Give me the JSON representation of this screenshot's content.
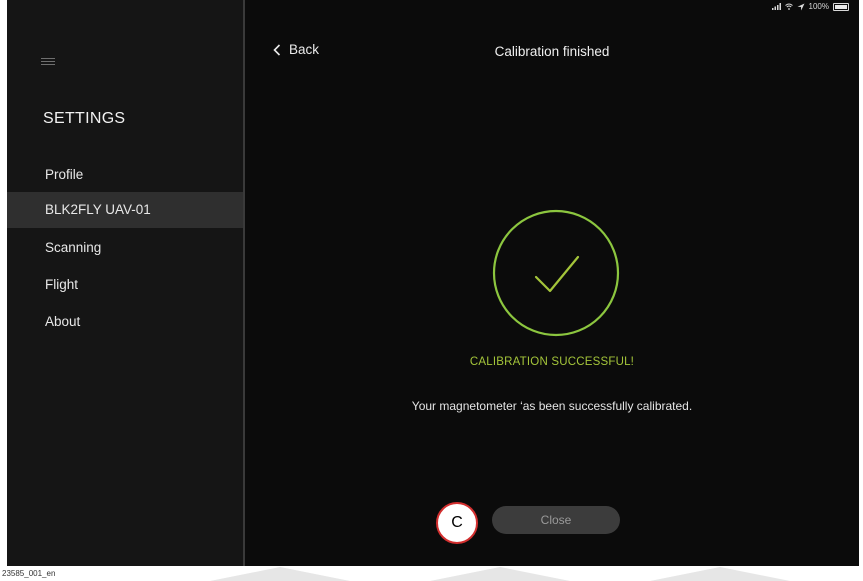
{
  "status_bar": {
    "battery": "100%"
  },
  "sidebar": {
    "title": "SETTINGS",
    "items": [
      {
        "label": "Profile",
        "active": false
      },
      {
        "label": "BLK2FLY UAV-01",
        "active": true
      },
      {
        "label": "Scanning",
        "active": false
      },
      {
        "label": "Flight",
        "active": false
      },
      {
        "label": "About",
        "active": false
      }
    ]
  },
  "header": {
    "back_label": "Back",
    "title": "Calibration finished"
  },
  "main": {
    "status": "CALIBRATION SUCCESSFUL!",
    "description": "Your magnetometer ‘as been successfully calibrated.",
    "close_label": "Close"
  },
  "callout": {
    "label": "C"
  },
  "caption": "23585_001_en",
  "colors": {
    "success": "#a4c53a",
    "background": "#0b0b0b",
    "sidebar": "#151515",
    "callout_border": "#d32f2f"
  }
}
